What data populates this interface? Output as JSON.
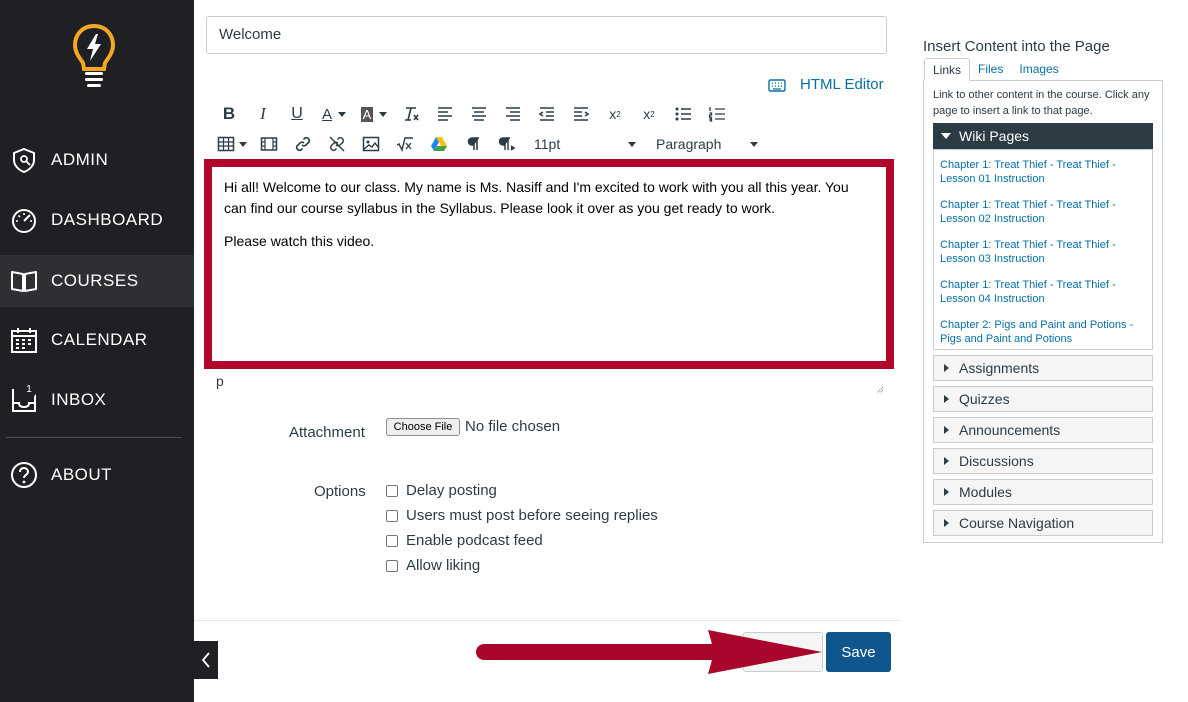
{
  "sidebar": {
    "items": [
      {
        "label": "ADMIN",
        "icon": "shield-icon"
      },
      {
        "label": "DASHBOARD",
        "icon": "speedometer-icon"
      },
      {
        "label": "COURSES",
        "icon": "book-icon",
        "active": true
      },
      {
        "label": "CALENDAR",
        "icon": "calendar-icon"
      },
      {
        "label": "INBOX",
        "icon": "inbox-icon",
        "badge": "1"
      },
      {
        "label": "ABOUT",
        "icon": "help-icon"
      }
    ]
  },
  "editor": {
    "title_value": "Welcome",
    "html_editor_label": "HTML Editor",
    "font_size": "11pt",
    "block_format": "Paragraph",
    "content": [
      "Hi all! Welcome to our class. My name is Ms. Nasiff and I'm excited to work with you all this year. You can find our course syllabus in the Syllabus. Please look it over as you get ready to work.",
      "Please watch this video."
    ],
    "path": "p"
  },
  "form": {
    "attachment_label": "Attachment",
    "choose_file_label": "Choose File",
    "no_file_label": "No file chosen",
    "options_label": "Options",
    "options": [
      "Delay posting",
      "Users must post before seeing replies",
      "Enable podcast feed",
      "Allow liking"
    ],
    "save_label": "Save"
  },
  "right_panel": {
    "title": "Insert Content into the Page",
    "tabs": [
      "Links",
      "Files",
      "Images"
    ],
    "description": "Link to other content in the course. Click any page to insert a link to that page.",
    "wiki_header": "Wiki Pages",
    "wiki_pages": [
      "Chapter 1: Treat Thief - Treat Thief - Lesson 01 Instruction",
      "Chapter 1: Treat Thief - Treat Thief - Lesson 02 Instruction",
      "Chapter 1: Treat Thief - Treat Thief - Lesson 03 Instruction",
      "Chapter 1: Treat Thief - Treat Thief - Lesson 04 Instruction",
      "Chapter 2: Pigs and Paint and Potions - Pigs and Paint and Potions"
    ],
    "sections": [
      "Assignments",
      "Quizzes",
      "Announcements",
      "Discussions",
      "Modules",
      "Course Navigation"
    ]
  },
  "colors": {
    "sidebar_bg": "#1f2024",
    "highlight_red": "#b0072b",
    "save_blue": "#0e568d",
    "link_blue": "#0770a3"
  }
}
